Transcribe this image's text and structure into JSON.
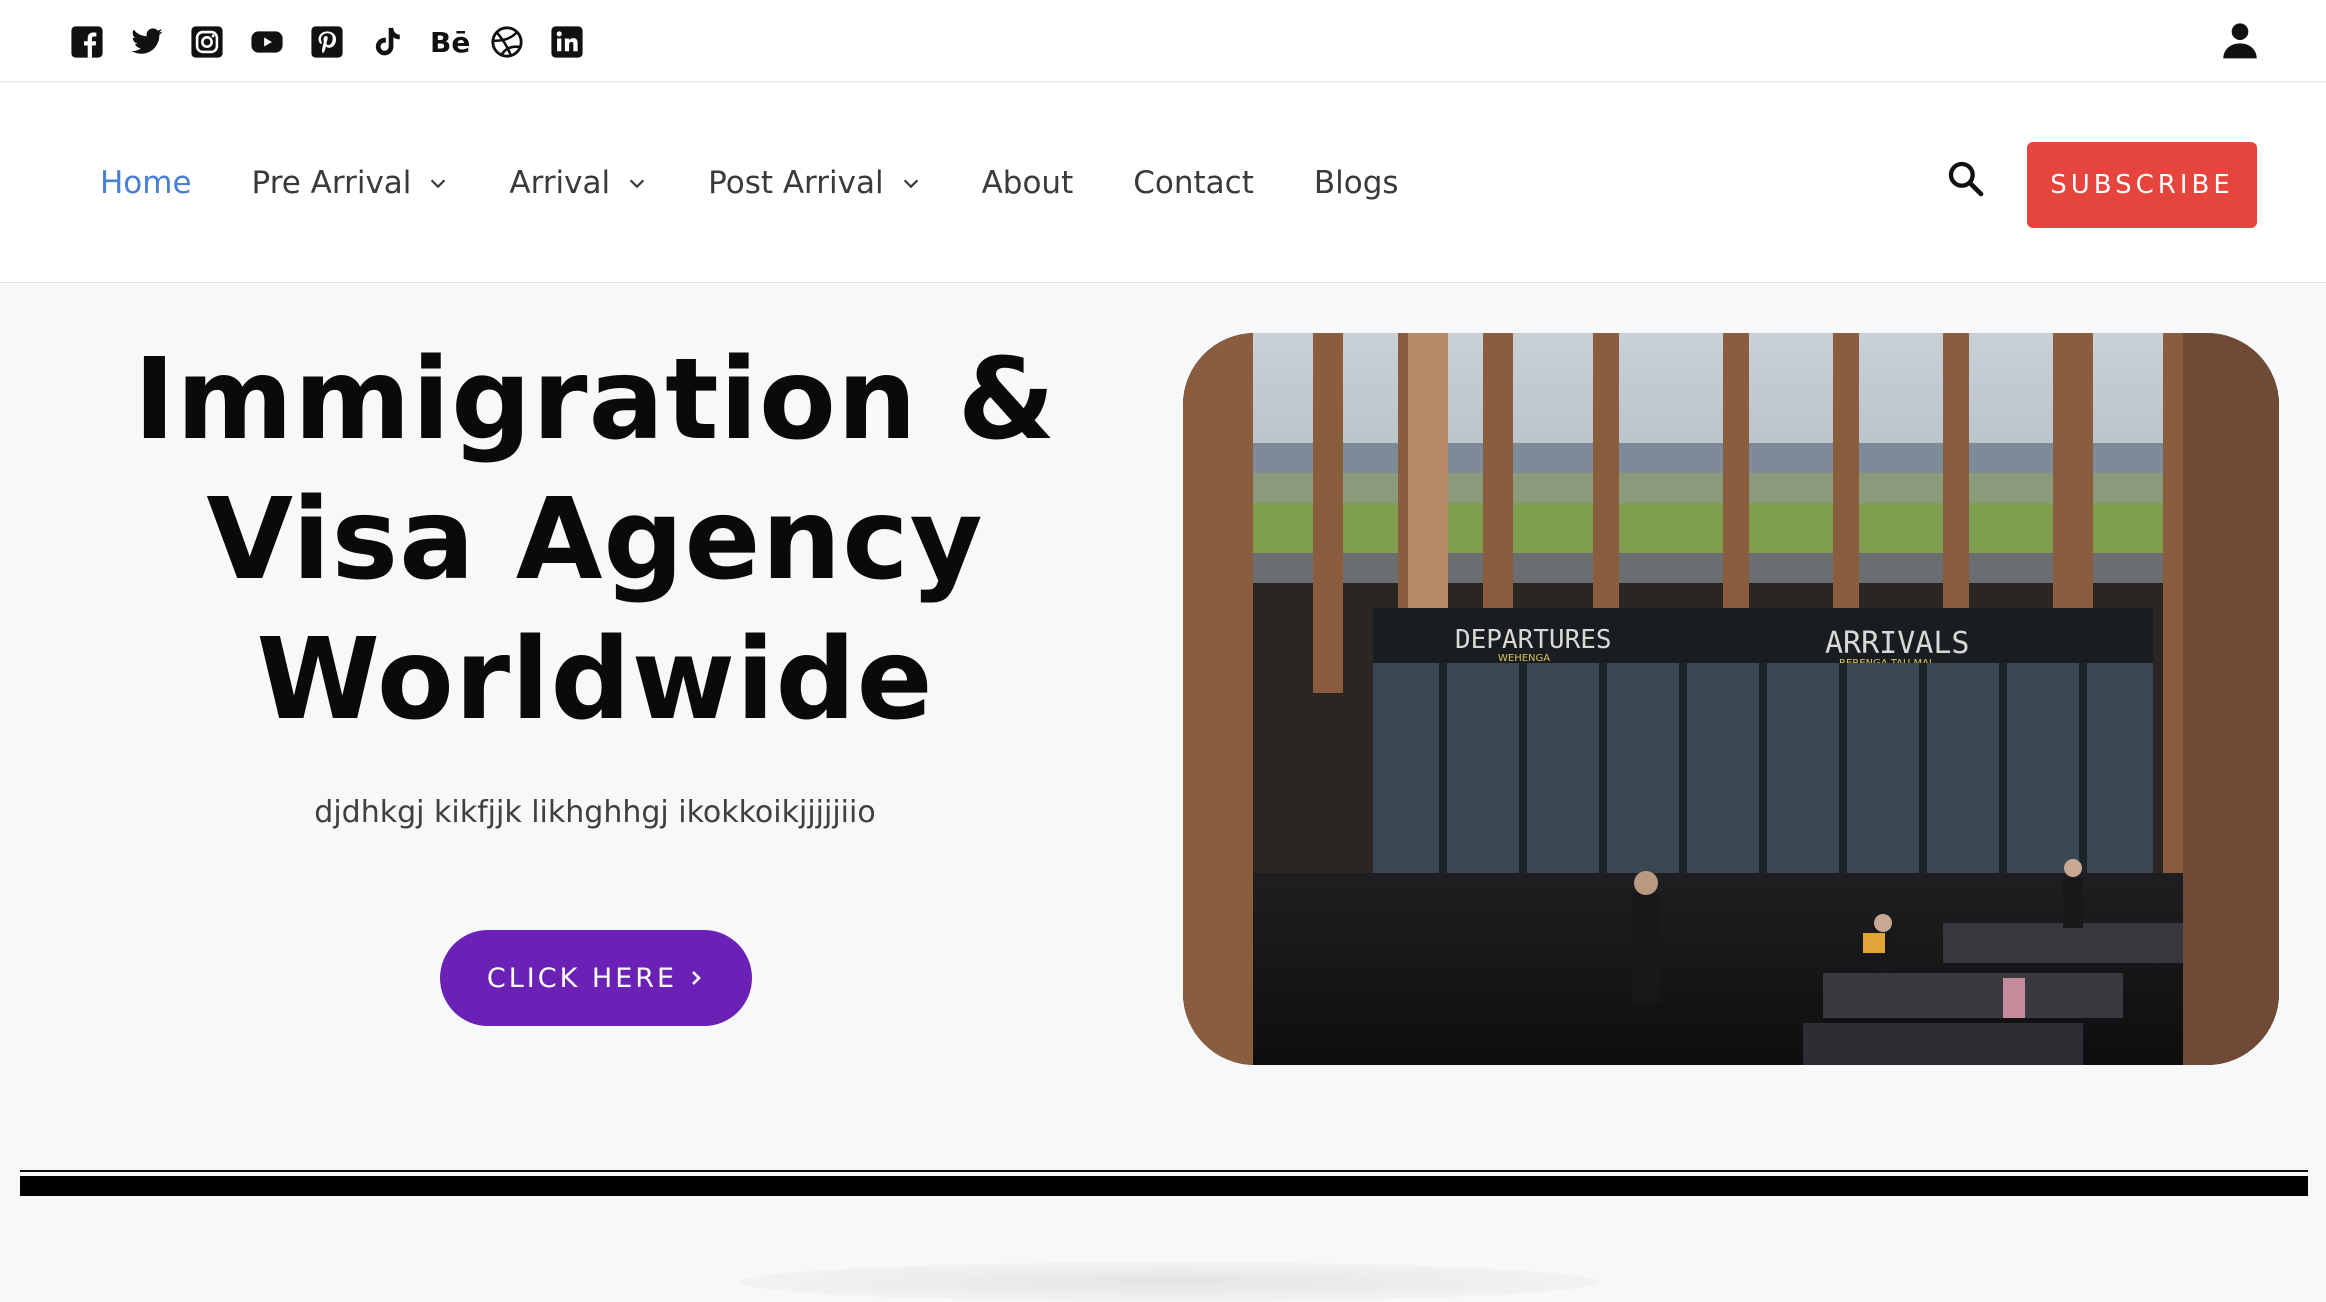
{
  "social_icons": [
    "facebook-icon",
    "twitter-icon",
    "instagram-icon",
    "youtube-icon",
    "pinterest-icon",
    "tiktok-icon",
    "behance-icon",
    "dribbble-icon",
    "linkedin-icon"
  ],
  "behance_text": "Bē",
  "nav": {
    "items": [
      {
        "label": "Home",
        "active": true,
        "dropdown": false
      },
      {
        "label": "Pre Arrival",
        "active": false,
        "dropdown": true
      },
      {
        "label": "Arrival",
        "active": false,
        "dropdown": true
      },
      {
        "label": "Post Arrival",
        "active": false,
        "dropdown": true
      },
      {
        "label": "About",
        "active": false,
        "dropdown": false
      },
      {
        "label": "Contact",
        "active": false,
        "dropdown": false
      },
      {
        "label": "Blogs",
        "active": false,
        "dropdown": false
      }
    ],
    "subscribe_label": "SUBSCRIBE"
  },
  "hero": {
    "title_line1": "Immigration &",
    "title_line2": "Visa Agency",
    "title_line3": "Worldwide",
    "subtitle": "djdhkgj kikfjjk likhghhgj ikokkoikjjjjjiio",
    "cta_label": "CLICK HERE",
    "image": {
      "sign_departures": "DEPARTURES",
      "sign_departures_sub": "WEHENGA",
      "sign_arrivals": "ARRIVALS",
      "sign_arrivals_sub": "RERENGA TAU MAI"
    }
  },
  "colors": {
    "accent_blue": "#4a7fd6",
    "subscribe_red": "#e5453c",
    "cta_purple": "#6b21b5",
    "page_bg": "#f7f8fa"
  }
}
